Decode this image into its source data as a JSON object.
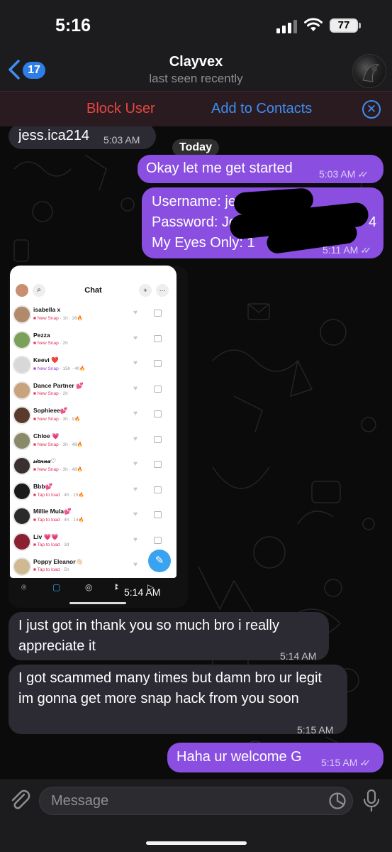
{
  "status_bar": {
    "time": "5:16",
    "battery": "77"
  },
  "header": {
    "back_count": "17",
    "contact_name": "Clayvex",
    "contact_status": "last seen recently"
  },
  "actions": {
    "block_user": "Block User",
    "add_to_contacts": "Add to Contacts",
    "close_symbol": "✕"
  },
  "chat": {
    "date_label": "Today",
    "messages": [
      {
        "direction": "in",
        "text": "jess.ica214",
        "time": "5:03 AM"
      },
      {
        "direction": "out",
        "text": "Okay let me get started",
        "time": "5:03 AM",
        "read": true
      },
      {
        "direction": "out",
        "lines": [
          "Username: je",
          "Password: Je",
          "My Eyes Only: 1"
        ],
        "trailing": "4",
        "time": "5:11 AM",
        "read": true
      },
      {
        "direction": "in",
        "type": "image",
        "time": "5:14 AM"
      },
      {
        "direction": "in",
        "text": "I just got in thank you so much bro i really appreciate it",
        "time": "5:14 AM"
      },
      {
        "direction": "in",
        "text": "I got scammed many times but damn bro ur legit im gonna get more snap hack from you soon",
        "time": "5:15 AM"
      },
      {
        "direction": "out",
        "text": "Haha ur welcome G",
        "time": "5:15 AM",
        "read": true
      }
    ]
  },
  "snap_screenshot": {
    "title": "Chat",
    "rows": [
      {
        "name": "isabella x",
        "status": "New Snap",
        "ago": "1h",
        "streak": "26",
        "status_color": "#e0305a",
        "avatar": "#b08a6a"
      },
      {
        "name": "Pezza",
        "status": "New Snap",
        "ago": "2h",
        "streak": "",
        "status_color": "#e0305a",
        "avatar": "#7aa05a"
      },
      {
        "name": "Keevi ❤️",
        "status": "New Snap",
        "ago": "15h",
        "streak": "40",
        "status_color": "#9b3fd6",
        "avatar": "#d8d8d8"
      },
      {
        "name": "Dance Partner 💕",
        "status": "New Snap",
        "ago": "2h",
        "streak": "",
        "status_color": "#e0305a",
        "avatar": "#c9a27e"
      },
      {
        "name": "Sophieee💕",
        "status": "New Snap",
        "ago": "3h",
        "streak": "9",
        "status_color": "#e0305a",
        "avatar": "#5a3a2a"
      },
      {
        "name": "Chloe 💗",
        "status": "New Snap",
        "ago": "3h",
        "streak": "48",
        "status_color": "#e0305a",
        "avatar": "#8a8a6a"
      },
      {
        "name": "𝓈𝒾𝑒𝓃𝓃𝒶♡",
        "status": "New Snap",
        "ago": "3h",
        "streak": "48",
        "status_color": "#e0305a",
        "avatar": "#3a3030"
      },
      {
        "name": "Bbb💕",
        "status": "Tap to load",
        "ago": "4h",
        "streak": "15",
        "status_color": "#e0305a",
        "avatar": "#1a1a1a"
      },
      {
        "name": "Millie Mula💕",
        "status": "Tap to load",
        "ago": "4h",
        "streak": "14",
        "status_color": "#e0305a",
        "avatar": "#2a2a2a"
      },
      {
        "name": "Liv 💗💗",
        "status": "Tap to load",
        "ago": "3d",
        "streak": "",
        "status_color": "#e0305a",
        "avatar": "#8a2030"
      },
      {
        "name": "Poppy Eleanor👋🏻",
        "status": "Tap to load",
        "ago": "5h",
        "streak": "",
        "status_color": "#e0305a",
        "avatar": "#d0b890"
      }
    ]
  },
  "input": {
    "placeholder": "Message"
  },
  "colors": {
    "outgoing_bubble": "#8a4fe0",
    "incoming_bubble": "#2c2a33",
    "accent_blue": "#3f8ef0",
    "destructive_red": "#e8473f"
  },
  "icons": [
    "back-chevron-icon",
    "signal-icon",
    "wifi-icon",
    "battery-icon",
    "close-circle-icon",
    "paperclip-icon",
    "sticker-icon",
    "microphone-icon",
    "read-checks-icon"
  ]
}
